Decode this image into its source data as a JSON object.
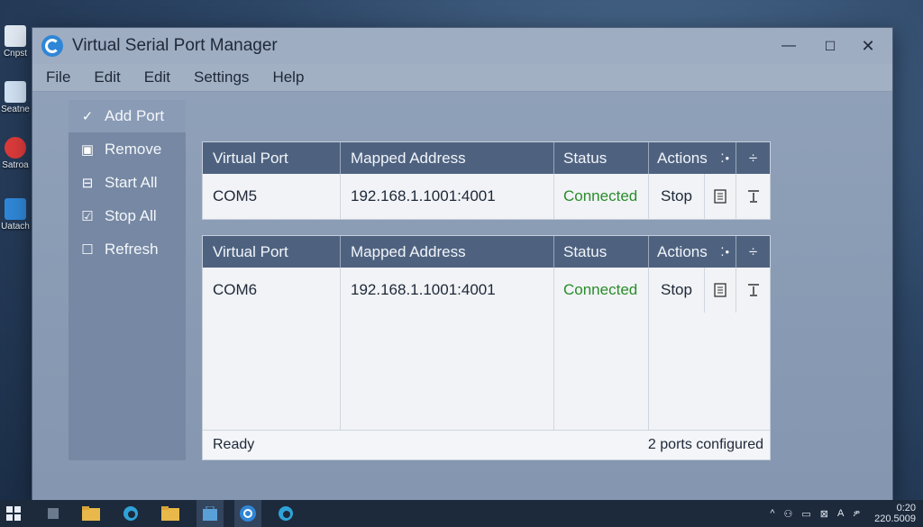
{
  "desktop": {
    "icons": [
      {
        "label": "Cnpst"
      },
      {
        "label": "Seatne"
      },
      {
        "label": "Satroa"
      },
      {
        "label": "Uatach"
      }
    ]
  },
  "window": {
    "title": "Virtual Serial Port Manager",
    "controls": {
      "minimize": "—",
      "maximize": "☐",
      "close": "✕"
    }
  },
  "menu": [
    "File",
    "Edit",
    "Edit",
    "Settings",
    "Help"
  ],
  "sidebar": {
    "items": [
      {
        "label": "Add Port",
        "icon": "check-icon",
        "glyph": "✓"
      },
      {
        "label": "Remove",
        "icon": "remove-icon",
        "glyph": "▣"
      },
      {
        "label": "Start All",
        "icon": "start-all-icon",
        "glyph": "⊟"
      },
      {
        "label": "Stop All",
        "icon": "stop-all-icon",
        "glyph": "☑"
      },
      {
        "label": "Refresh",
        "icon": "refresh-icon",
        "glyph": "☐"
      }
    ]
  },
  "tables": [
    {
      "headers": [
        "Virtual Port",
        "Mapped Address",
        "Status",
        "Actions",
        "⁚•",
        "÷"
      ],
      "row": {
        "port": "COM5",
        "address": "192.168.1.1001:4001",
        "status": "Connected",
        "action": "Stop"
      }
    },
    {
      "headers": [
        "Virtual Port",
        "Mapped Address",
        "Status",
        "Actions",
        "⁚•",
        "÷"
      ],
      "row": {
        "port": "COM6",
        "address": "192.168.1.1001:4001",
        "status": "Connected",
        "action": "Stop"
      }
    }
  ],
  "statusbar": {
    "left": "Ready",
    "right": "2 ports configured"
  },
  "taskbar": {
    "tray": [
      "^",
      "⚇",
      "▭",
      "⊠",
      "A",
      "ዎ"
    ],
    "time": "0:20",
    "date": "220.5009"
  },
  "colors": {
    "accent": "#2f86d6",
    "header": "#4e6280",
    "status_ok": "#2a8c2a"
  }
}
